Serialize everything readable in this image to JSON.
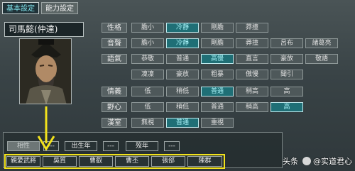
{
  "tabs": [
    {
      "label": "基本設定",
      "active": true
    },
    {
      "label": "能力設定",
      "active": false
    }
  ],
  "header_watermark": "",
  "general": {
    "name": "司馬懿(仲達)"
  },
  "attributes": [
    {
      "label": "性格",
      "options": [
        "膽小",
        "冷靜",
        "剛膽",
        "莽撞"
      ],
      "selected": 1
    },
    {
      "label": "音聲",
      "options": [
        "膽小",
        "冷靜",
        "剛膽",
        "莽撞",
        "呂布",
        "諸葛亮"
      ],
      "selected": 1
    },
    {
      "label": "語氣",
      "options": [
        "恭敬",
        "普通",
        "高慢",
        "直言",
        "豪放",
        "敬語"
      ],
      "selected": 2
    },
    {
      "label": "",
      "options": [
        "凜凜",
        "豪放",
        "粗暴",
        "傲慢",
        "聞引"
      ],
      "selected": -1
    },
    {
      "label": "情義",
      "options": [
        "低",
        "稍低",
        "普通",
        "稍高",
        "高"
      ],
      "selected": 2
    },
    {
      "label": "野心",
      "options": [
        "低",
        "稍低",
        "普通",
        "稍高",
        "高"
      ],
      "selected": 4
    },
    {
      "label": "漢室",
      "options": [
        "無視",
        "普通",
        "重視"
      ],
      "selected": 1
    }
  ],
  "lower": {
    "relation_label": "相性",
    "birth_label": "出生年",
    "death_label": "歿年",
    "empty_value": "---"
  },
  "relations": {
    "header": "親愛武將",
    "names": [
      "吳質",
      "曹叡",
      "曹丕",
      "張郃",
      "陳群"
    ]
  },
  "watermark": {
    "prefix": "头条",
    "handle": "@实道君心"
  },
  "colors": {
    "selected": "#1f6f76",
    "highlight": "#f2e21c"
  }
}
